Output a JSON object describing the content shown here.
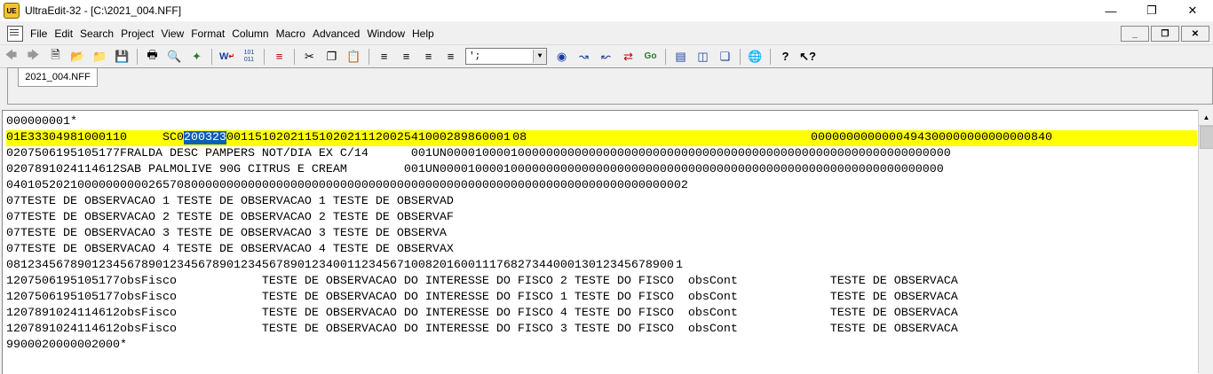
{
  "window": {
    "title": "UltraEdit-32 - [C:\\2021_004.NFF]",
    "app_icon_text": "UE"
  },
  "menu": [
    "File",
    "Edit",
    "Search",
    "Project",
    "View",
    "Format",
    "Column",
    "Macro",
    "Advanced",
    "Window",
    "Help"
  ],
  "toolbar": {
    "combo_value": "';"
  },
  "tab": {
    "label": "2021_004.NFF"
  },
  "editor": {
    "line_1": "000000001*",
    "line_2_before": "01E33304981000110     SC0",
    "line_2_selected": "200323",
    "line_2_after": "0011510202115102021112002541000289860001 08                                        0000000000000494300000000000000840",
    "line_3": "0207506195105177FRALDA DESC PAMPERS NOT/DIA EX C/14      001UN00001000010000000000000000000000000000000000000000000000000000000000000",
    "line_4": "0207891024114612SAB PALMOLIVE 90G CITRUS E CREAM        001UN00001000010000000000000000000000000000000000000000000000000000000000000",
    "line_5": "040105202100000000002657080000000000000000000000000000000000000000000000000000000000000000000002",
    "line_6": "07TESTE DE OBSERVACAO 1 TESTE DE OBSERVACAO 1 TESTE DE OBSERVAD",
    "line_7": "07TESTE DE OBSERVACAO 2 TESTE DE OBSERVACAO 2 TESTE DE OBSERVAF",
    "line_8": "07TESTE DE OBSERVACAO 3 TESTE DE OBSERVACAO 3 TESTE DE OBSERVA",
    "line_9": "07TESTE DE OBSERVACAO 4 TESTE DE OBSERVACAO 4 TESTE DE OBSERVAX",
    "line_10": "0812345678901234567890123456789012345678901234001123456710082016001117682734400013012345678900 1",
    "line_11": "1207506195105177obsFisco            TESTE DE OBSERVACAO DO INTERESSE DO FISCO 2 TESTE DO FISCO  obsCont             TESTE DE OBSERVACA",
    "line_12": "1207506195105177obsFisco            TESTE DE OBSERVACAO DO INTERESSE DO FISCO 1 TESTE DO FISCO  obsCont             TESTE DE OBSERVACA",
    "line_13": "1207891024114612obsFisco            TESTE DE OBSERVACAO DO INTERESSE DO FISCO 4 TESTE DO FISCO  obsCont             TESTE DE OBSERVACA",
    "line_14": "1207891024114612obsFisco            TESTE DE OBSERVACAO DO INTERESSE DO FISCO 3 TESTE DO FISCO  obsCont             TESTE DE OBSERVACA",
    "line_15": "9900020000002000*"
  },
  "colors": {
    "highlight": "#ffff00",
    "selection": "#0a5fb5"
  }
}
